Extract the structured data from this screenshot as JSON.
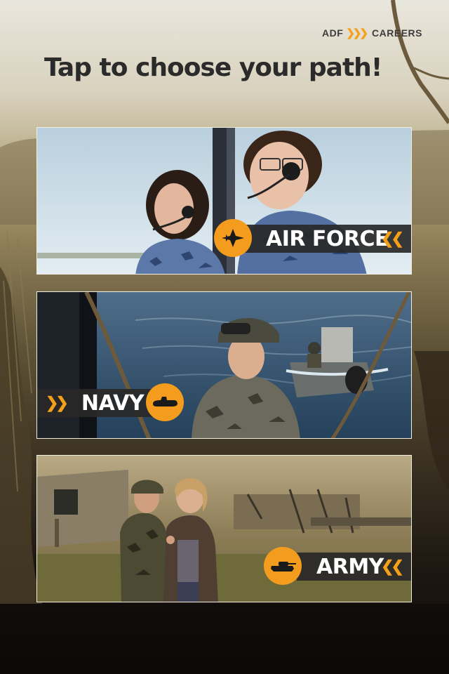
{
  "header": {
    "logo_left": "ADF",
    "logo_right": "CAREERS",
    "title": "Tap to choose your path!"
  },
  "paths": [
    {
      "label": "AIR FORCE",
      "icon": "jet-icon"
    },
    {
      "label": "NAVY",
      "icon": "submarine-icon"
    },
    {
      "label": "ARMY",
      "icon": "tank-icon"
    }
  ],
  "colors": {
    "accent": "#f39c1e",
    "label_bar": "#282828",
    "headline": "#2b2b2b"
  }
}
